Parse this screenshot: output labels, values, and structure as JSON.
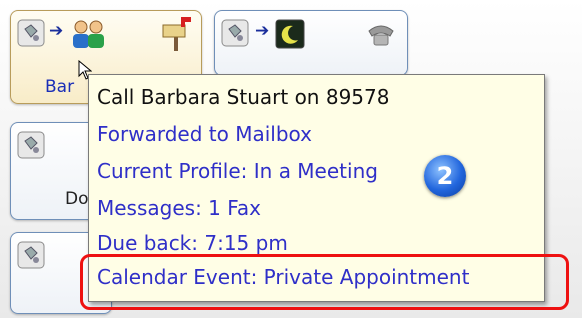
{
  "tiles": [
    {
      "name_visible": "Bar",
      "state": "active"
    },
    {
      "name_visible": "Do",
      "state": "normal"
    }
  ],
  "tooltip": {
    "header": "Call Barbara Stuart on 89578",
    "lines": [
      "Forwarded to Mailbox",
      "Current Profile: In a Meeting",
      "Messages: 1 Fax",
      "Due back: 7:15 pm",
      "Calendar Event: Private Appointment"
    ],
    "step_badge": "2"
  },
  "colors": {
    "link_text": "#2f2fc8",
    "tooltip_bg": "#fffee6",
    "highlight": "#e11111",
    "badge": "#2266dd"
  },
  "icons": [
    "phone-icon",
    "arrow-right-icon",
    "people-icon",
    "mailbox-icon",
    "moon-icon",
    "telephone-icon"
  ]
}
